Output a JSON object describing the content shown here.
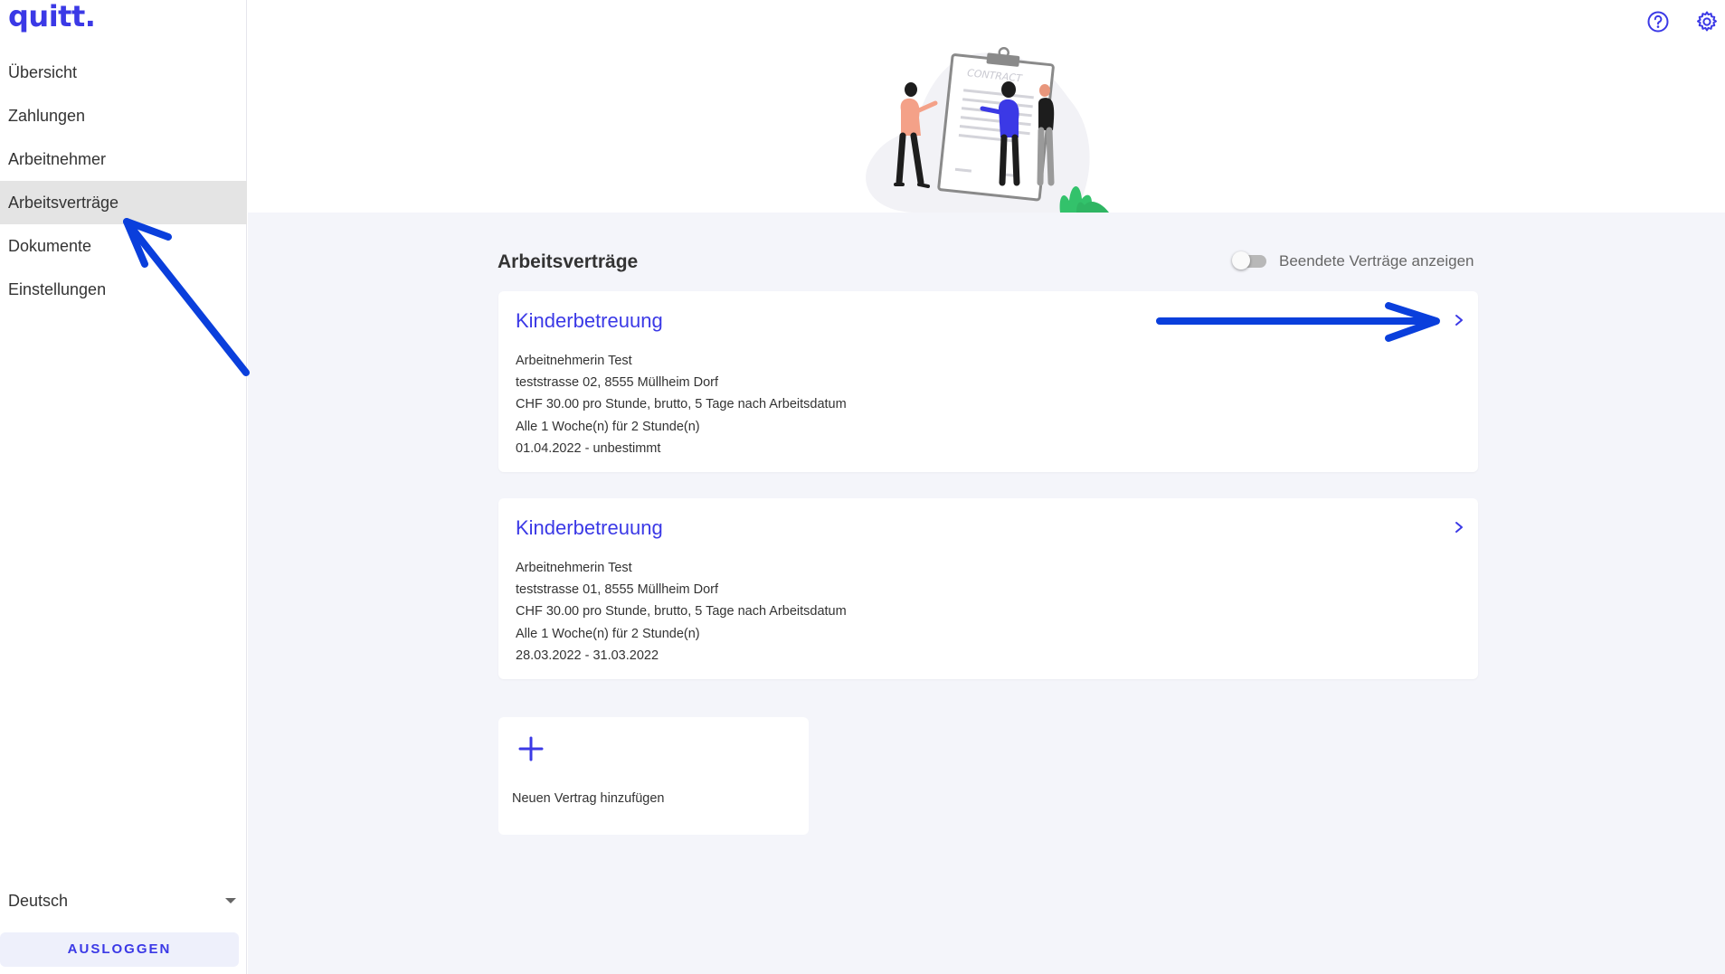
{
  "app": {
    "logo": "quitt."
  },
  "sidebar": {
    "items": [
      {
        "label": "Übersicht"
      },
      {
        "label": "Zahlungen"
      },
      {
        "label": "Arbeitnehmer"
      },
      {
        "label": "Arbeitsverträge",
        "active": true
      },
      {
        "label": "Dokumente"
      },
      {
        "label": "Einstellungen"
      }
    ],
    "language": "Deutsch",
    "logout_label": "AUSLOGGEN"
  },
  "header": {
    "icons": [
      "help-icon",
      "gear-icon"
    ],
    "illustration_text": "CONTRACT"
  },
  "main": {
    "title": "Arbeitsverträge",
    "toggle": {
      "label": "Beendete Verträge anzeigen",
      "checked": false
    },
    "contracts": [
      {
        "title": "Kinderbetreuung",
        "lines": [
          "Arbeitnehmerin Test",
          "teststrasse 02, 8555 Müllheim Dorf",
          "CHF 30.00 pro Stunde, brutto, 5 Tage nach Arbeitsdatum",
          "Alle 1 Woche(n) für 2 Stunde(n)",
          "01.04.2022 - unbestimmt"
        ]
      },
      {
        "title": "Kinderbetreuung",
        "lines": [
          "Arbeitnehmerin Test",
          "teststrasse 01, 8555 Müllheim Dorf",
          "CHF 30.00 pro Stunde, brutto, 5 Tage nach Arbeitsdatum",
          "Alle 1 Woche(n) für 2 Stunde(n)",
          "28.03.2022 - 31.03.2022"
        ]
      }
    ],
    "add_contract_label": "Neuen Vertrag hinzufügen"
  },
  "colors": {
    "accent": "#3b39e6",
    "annotation": "#0a3fdc",
    "main_bg": "#f4f5fa",
    "active_nav_bg": "#e4e4e4"
  }
}
